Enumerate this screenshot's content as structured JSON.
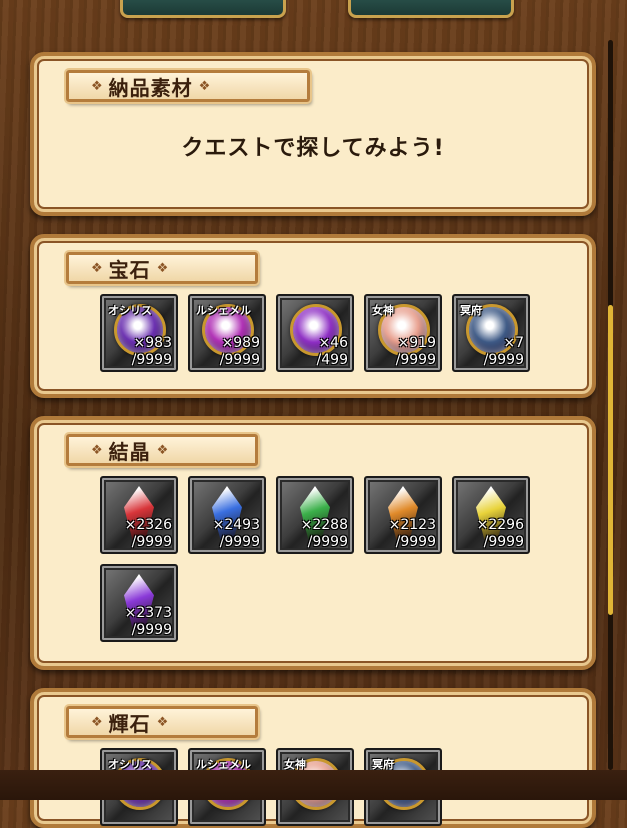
{
  "delivery": {
    "title": "納品素材",
    "empty_message": "クエストで探してみよう!"
  },
  "gems": {
    "title": "宝石",
    "items": [
      {
        "label": "オシリス",
        "count": "×983",
        "max": "/9999",
        "color": "#6a2fb0"
      },
      {
        "label": "ルシェメル",
        "count": "×989",
        "max": "/9999",
        "color": "#b02fb5"
      },
      {
        "label": "",
        "count": "×46",
        "max": "/499",
        "color": "#8e2fc4"
      },
      {
        "label": "女神",
        "count": "×919",
        "max": "/9999",
        "color": "#e8a08f"
      },
      {
        "label": "冥府",
        "count": "×7",
        "max": "/9999",
        "color": "#3e5a86"
      }
    ]
  },
  "crystals": {
    "title": "結晶",
    "items": [
      {
        "count": "×2326",
        "max": "/9999",
        "color": "#d8353a"
      },
      {
        "count": "×2493",
        "max": "/9999",
        "color": "#3a6fe0"
      },
      {
        "count": "×2288",
        "max": "/9999",
        "color": "#3bb04a"
      },
      {
        "count": "×2123",
        "max": "/9999",
        "color": "#e08a2a"
      },
      {
        "count": "×2296",
        "max": "/9999",
        "color": "#e8d33a"
      },
      {
        "count": "×2373",
        "max": "/9999",
        "color": "#8a3ad8"
      }
    ]
  },
  "radiant": {
    "title": "輝石",
    "items": [
      {
        "label": "オシリス",
        "color": "#6a2fb0"
      },
      {
        "label": "ルシェメル",
        "color": "#b02fb5"
      },
      {
        "label": "女神",
        "color": "#e8a08f"
      },
      {
        "label": "冥府",
        "color": "#3e5a86"
      }
    ]
  }
}
